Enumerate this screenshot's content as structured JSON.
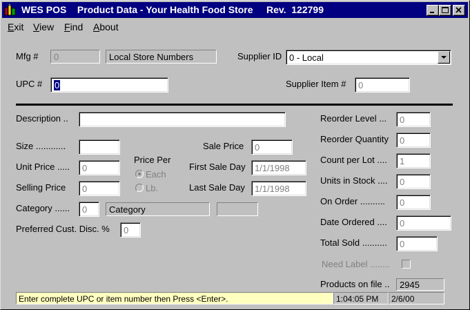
{
  "window": {
    "title": "WES POS    Product Data - Your Health Food Store     Rev.  122799",
    "controls": {
      "minimize": "minimize",
      "maximize": "maximize",
      "close": "close"
    }
  },
  "menu": {
    "exit": {
      "first": "E",
      "rest": "xit"
    },
    "view": {
      "first": "V",
      "rest": "iew"
    },
    "find": {
      "first": "F",
      "rest": "ind"
    },
    "about": {
      "first": "A",
      "rest": "bout"
    }
  },
  "header": {
    "mfg_label": "Mfg #",
    "mfg_value": "0",
    "mfg_name": "Local Store Numbers",
    "supplier_id_label": "Supplier ID",
    "supplier_id_value": "0 - Local",
    "upc_label": "UPC #",
    "upc_value": "0",
    "supplier_item_label": "Supplier Item #",
    "supplier_item_value": "0"
  },
  "left": {
    "description_label": "Description ..",
    "description_value": "",
    "size_label": "Size ............",
    "size_value": "",
    "unit_price_label": "Unit Price .....",
    "unit_price_value": "0",
    "selling_price_label": "Selling Price",
    "selling_price_value": "0",
    "category_label": "Category ......",
    "category_value": "0",
    "category_name": "Category",
    "category_extra": "",
    "pref_disc_label": "Preferred Cust. Disc. %",
    "pref_disc_value": "0",
    "price_per_label": "Price Per",
    "price_per_each": "Each",
    "price_per_lb": "Lb.",
    "sale_price_label": "Sale Price",
    "sale_price_value": "0",
    "first_sale_day_label": "First Sale Day",
    "first_sale_day_value": "1/1/1998",
    "last_sale_day_label": "Last Sale Day",
    "last_sale_day_value": "1/1/1998"
  },
  "right": {
    "reorder_level_label": "Reorder Level ...",
    "reorder_level_value": "0",
    "reorder_qty_label": "Reorder Quantity",
    "reorder_qty_value": "0",
    "count_per_lot_label": "Count per Lot ....",
    "count_per_lot_value": "1",
    "units_in_stock_label": "Units in Stock ....",
    "units_in_stock_value": "0",
    "on_order_label": "On Order ..........",
    "on_order_value": "0",
    "date_ordered_label": "Date Ordered ....",
    "date_ordered_value": "0",
    "total_sold_label": "Total Sold ..........",
    "total_sold_value": "0",
    "need_label_label": "Need Label ........",
    "products_on_file_label": "Products on file ..",
    "products_on_file_value": "2945"
  },
  "status": {
    "message": "Enter complete UPC or item number then Press <Enter>.",
    "time": "1:04:05 PM",
    "date": "2/6/00"
  },
  "colors": {
    "title_bar": "#000080",
    "face": "#c0c0c0",
    "status_bg": "#ffffc0",
    "disabled_text": "#808080"
  }
}
